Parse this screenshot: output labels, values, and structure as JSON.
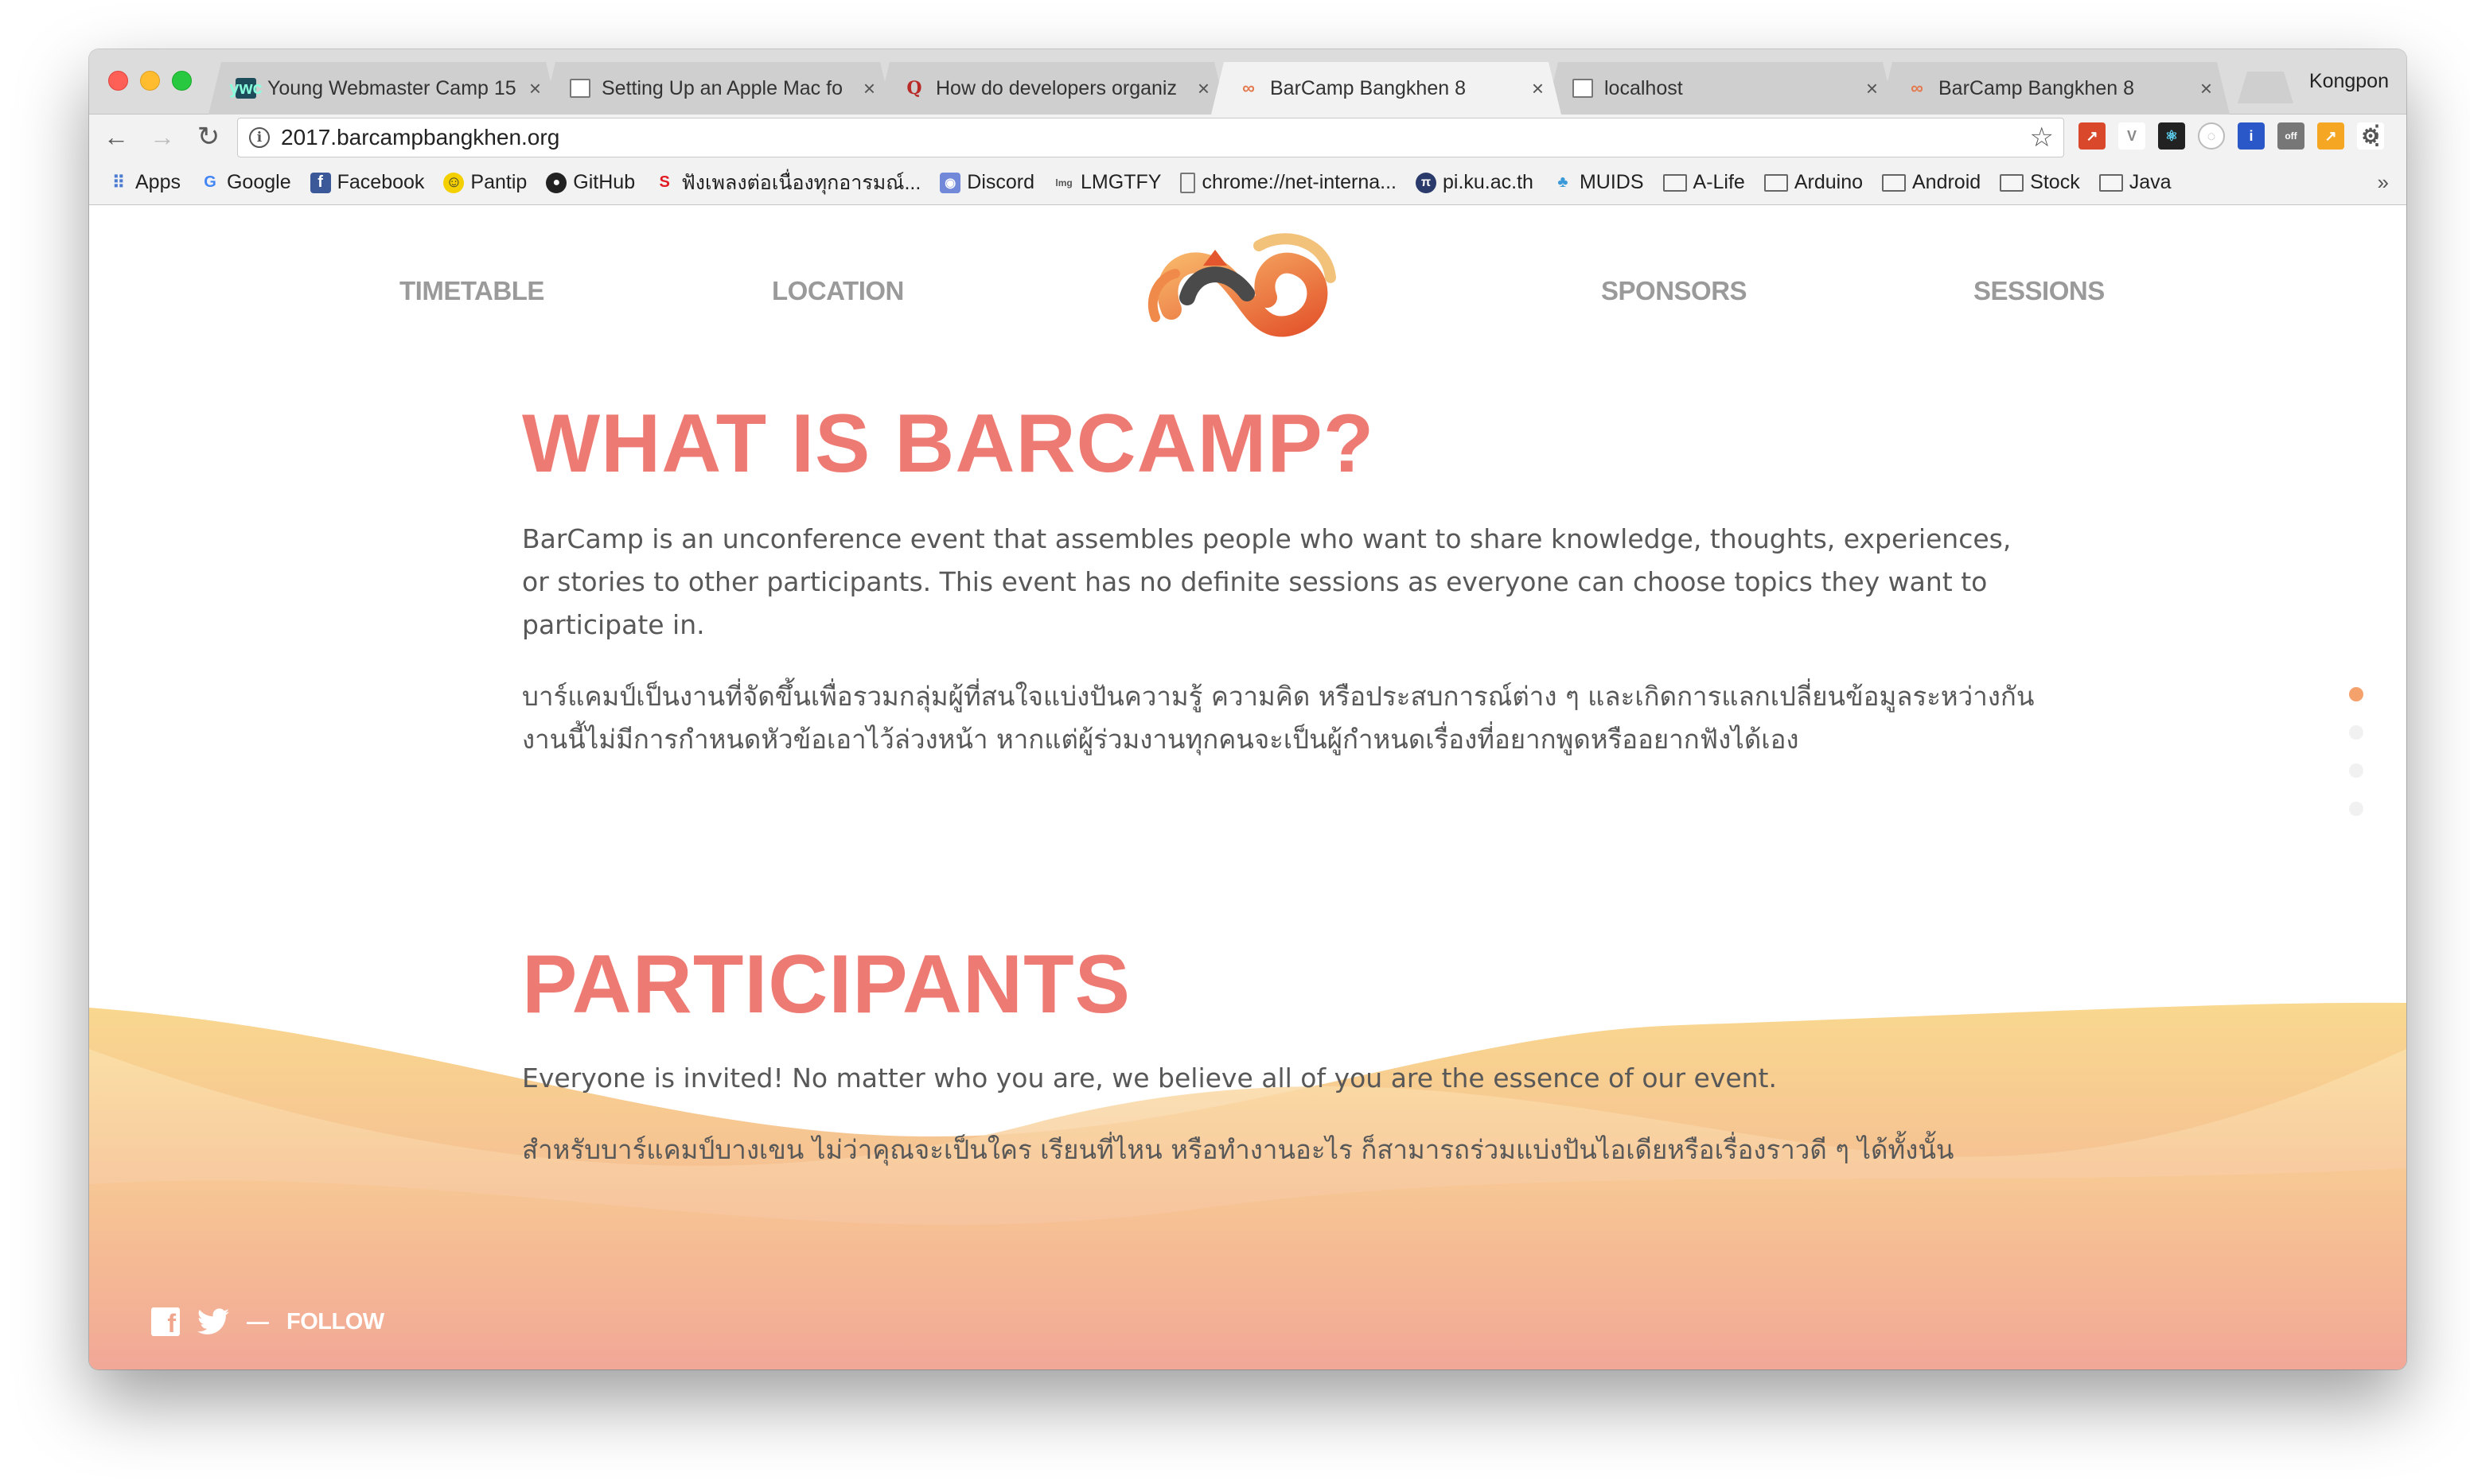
{
  "browser": {
    "tabs": [
      {
        "title": "Young Webmaster Camp 15",
        "icon": "ywc-favicon",
        "active": false
      },
      {
        "title": "Setting Up an Apple Mac fo",
        "icon": "document-icon",
        "active": false
      },
      {
        "title": "How do developers organiz",
        "icon": "quora-icon",
        "active": false
      },
      {
        "title": "BarCamp Bangkhen 8",
        "icon": "barcamp-favicon",
        "active": true
      },
      {
        "title": "localhost",
        "icon": "document-icon",
        "active": false
      },
      {
        "title": "BarCamp Bangkhen 8",
        "icon": "barcamp-favicon",
        "active": false
      }
    ],
    "close_glyph": "×",
    "profile_name": "Kongpon",
    "url": "2017.barcampbangkhen.org",
    "bookmarks": [
      {
        "label": "Apps",
        "icon": "apps-grid-icon"
      },
      {
        "label": "Google",
        "icon": "google-icon"
      },
      {
        "label": "Facebook",
        "icon": "facebook-icon"
      },
      {
        "label": "Pantip",
        "icon": "pantip-icon"
      },
      {
        "label": "GitHub",
        "icon": "github-icon"
      },
      {
        "label": "ฟังเพลงต่อเนื่องทุกอารมณ์...",
        "icon": "music-icon"
      },
      {
        "label": "Discord",
        "icon": "discord-icon"
      },
      {
        "label": "LMGTFY",
        "icon": "lmgtfy-icon"
      },
      {
        "label": "chrome://net-interna...",
        "icon": "document-icon"
      },
      {
        "label": "pi.ku.ac.th",
        "icon": "pi-icon"
      },
      {
        "label": "MUIDS",
        "icon": "muids-icon"
      },
      {
        "label": "A-Life",
        "icon": "folder-icon"
      },
      {
        "label": "Arduino",
        "icon": "folder-icon"
      },
      {
        "label": "Android",
        "icon": "folder-icon"
      },
      {
        "label": "Stock",
        "icon": "folder-icon"
      },
      {
        "label": "Java",
        "icon": "folder-icon"
      }
    ],
    "bookmarks_overflow": "»"
  },
  "site": {
    "nav": {
      "timetable": "TIMETABLE",
      "location": "LOCATION",
      "sponsors": "SPONSORS",
      "sessions": "SESSIONS"
    },
    "what": {
      "heading": "WHAT IS BARCAMP?",
      "body_en": "BarCamp is an unconference event that assembles people who want to share knowledge, thoughts, experiences, or stories to other participants. This event has no definite sessions as everyone can choose topics they want to participate in.",
      "body_th": "บาร์แคมป์เป็นงานที่จัดขึ้นเพื่อรวมกลุ่มผู้ที่สนใจแบ่งปันความรู้ ความคิด หรือประสบการณ์ต่าง ๆ และเกิดการแลกเปลี่ยนข้อมูลระหว่างกัน งานนี้ไม่มีการกำหนดหัวข้อเอาไว้ล่วงหน้า หากแต่ผู้ร่วมงานทุกคนจะเป็นผู้กำหนดเรื่องที่อยากพูดหรืออยากฟังได้เอง"
    },
    "participants": {
      "heading": "PARTICIPANTS",
      "body_en": "Everyone is invited! No matter who you are, we believe all of you are the essence of our event.",
      "body_th": "สำหรับบาร์แคมป์บางเขน ไม่ว่าคุณจะเป็นใคร เรียนที่ไหน หรือทำงานอะไร ก็สามารถร่วมแบ่งปันไอเดียหรือเรื่องราวดี ๆ ได้ทั้งนั้น"
    },
    "footer": {
      "dash": "—",
      "follow_label": "FOLLOW"
    },
    "colors": {
      "accent": "#ee7b73",
      "nav_text": "#9a9a9a",
      "body_text": "#585858",
      "wave_top": "#f9d88f",
      "wave_bottom": "#f2a797",
      "active_dot": "#f4a16c"
    },
    "section_dots": {
      "count": 4,
      "active_index": 0
    }
  }
}
